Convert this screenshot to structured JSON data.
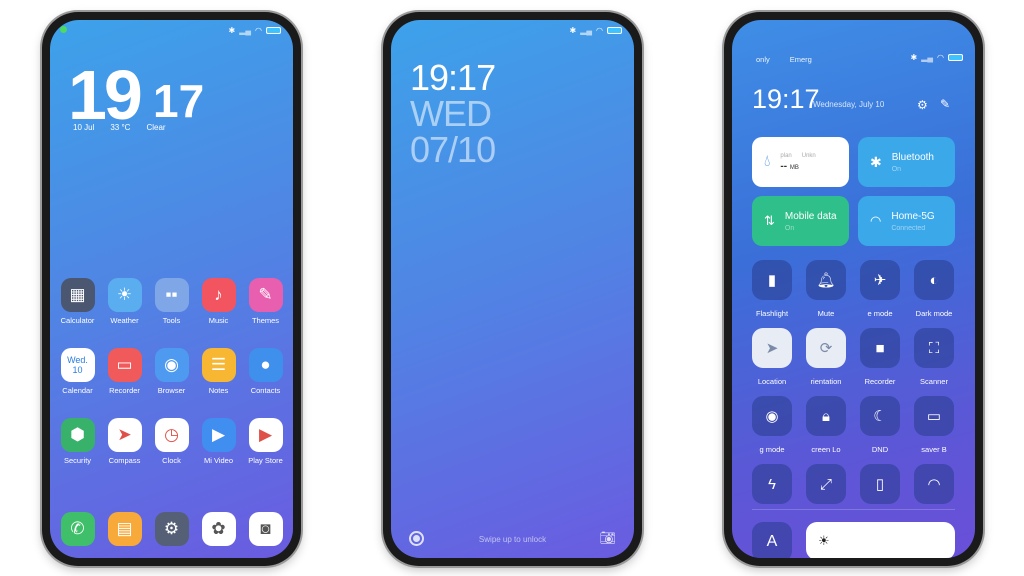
{
  "home": {
    "hour": "19",
    "minute": "17",
    "date": "10 Jul",
    "temp": "33 °C",
    "weather": "Clear",
    "apps": [
      {
        "label": "Calculator",
        "icon": "calculator-icon",
        "color": "#4b5670"
      },
      {
        "label": "Weather",
        "icon": "weather-icon",
        "color": "#5aaef0"
      },
      {
        "label": "Tools",
        "icon": "tools-folder-icon",
        "color": "#7fa6e6"
      },
      {
        "label": "Music",
        "icon": "music-icon",
        "color": "#f2555f"
      },
      {
        "label": "Themes",
        "icon": "themes-icon",
        "color": "#e85fb0"
      },
      {
        "label": "Calendar",
        "icon": "calendar-icon",
        "color": "#ffffff",
        "text": "Wed. 10"
      },
      {
        "label": "Recorder",
        "icon": "recorder-icon",
        "color": "#f05a5a"
      },
      {
        "label": "Browser",
        "icon": "browser-icon",
        "color": "#4e9af0"
      },
      {
        "label": "Notes",
        "icon": "notes-icon",
        "color": "#f7b733"
      },
      {
        "label": "Contacts",
        "icon": "contacts-icon",
        "color": "#3f90ec"
      },
      {
        "label": "Security",
        "icon": "security-icon",
        "color": "#38b26a"
      },
      {
        "label": "Compass",
        "icon": "compass-icon",
        "color": "#ffffff"
      },
      {
        "label": "Clock",
        "icon": "clock-icon",
        "color": "#ffffff"
      },
      {
        "label": "Mi Video",
        "icon": "video-icon",
        "color": "#3f8ef0"
      },
      {
        "label": "Play Store",
        "icon": "play-store-icon",
        "color": "#ffffff"
      }
    ],
    "dock": [
      {
        "icon": "phone-icon",
        "color": "#3fbf6a"
      },
      {
        "icon": "messages-icon",
        "color": "#f7a93a"
      },
      {
        "icon": "settings-icon",
        "color": "#556076"
      },
      {
        "icon": "gallery-icon",
        "color": "#ffffff"
      },
      {
        "icon": "camera-icon",
        "color": "#ffffff"
      }
    ]
  },
  "lock": {
    "time": "19:17",
    "day": "WED",
    "date": "07/10",
    "hint": "Swipe up to unlock"
  },
  "control": {
    "carrier1": "only",
    "carrier2": "Emerg",
    "time": "19:17",
    "date": "Wednesday, July 10",
    "data_tile": {
      "title": "plan",
      "sub": "Unkn",
      "value": "--",
      "unit": "MB"
    },
    "bluetooth": {
      "title": "Bluetooth",
      "status": "On"
    },
    "mobile": {
      "title": "Mobile data",
      "status": "On"
    },
    "wifi": {
      "title": "Home-5G",
      "status": "Connected"
    },
    "toggles": [
      {
        "label": "Flashlight",
        "icon": "flashlight-icon"
      },
      {
        "label": "Mute",
        "icon": "bell-icon"
      },
      {
        "label": "e mode",
        "icon": "airplane-icon"
      },
      {
        "label": "Dark mode",
        "icon": "dark-mode-icon"
      },
      {
        "label": "Location",
        "icon": "location-icon",
        "on": true
      },
      {
        "label": "rientation",
        "icon": "rotation-lock-icon",
        "on": true
      },
      {
        "label": "Recorder",
        "icon": "video-recorder-icon"
      },
      {
        "label": "Scanner",
        "icon": "scanner-icon"
      },
      {
        "label": "g mode",
        "icon": "eye-icon"
      },
      {
        "label": "creen  Lo",
        "icon": "lock-icon"
      },
      {
        "label": "DND",
        "icon": "moon-icon"
      },
      {
        "label": "saver  B",
        "icon": "battery-saver-icon"
      },
      {
        "label": "",
        "icon": "flash-icon"
      },
      {
        "label": "",
        "icon": "resize-icon"
      },
      {
        "label": "",
        "icon": "vibrate-icon"
      },
      {
        "label": "",
        "icon": "hotspot-icon"
      }
    ],
    "auto_brightness": "A"
  }
}
